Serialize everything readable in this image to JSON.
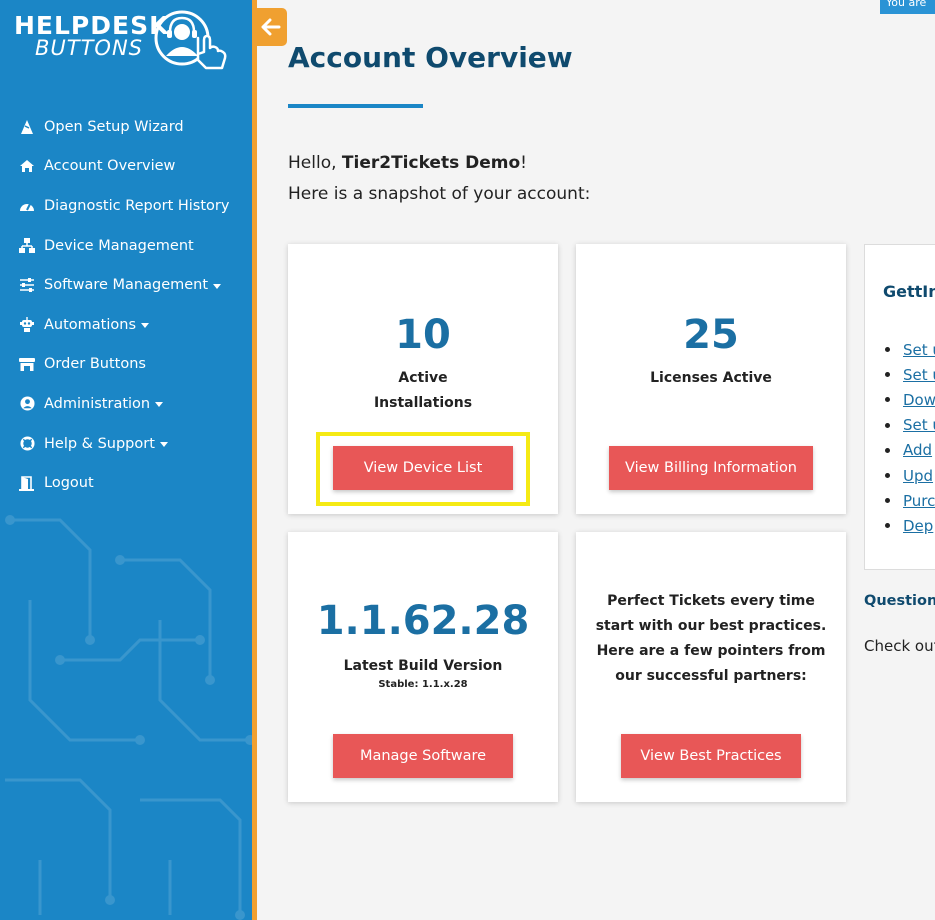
{
  "logo": {
    "line1": "HELPDESK",
    "line2": "BUTTONS"
  },
  "topbar": {
    "chip_text": "You are"
  },
  "nav": [
    {
      "label": "Open Setup Wizard",
      "icon": "wizard-hat-icon",
      "caret": false
    },
    {
      "label": "Account Overview",
      "icon": "home-icon",
      "caret": false
    },
    {
      "label": "Diagnostic Report History",
      "icon": "tachometer-icon",
      "caret": false
    },
    {
      "label": "Device Management",
      "icon": "network-icon",
      "caret": false
    },
    {
      "label": "Software Management",
      "icon": "sliders-icon",
      "caret": true
    },
    {
      "label": "Automations",
      "icon": "robot-icon",
      "caret": true
    },
    {
      "label": "Order Buttons",
      "icon": "store-icon",
      "caret": false
    },
    {
      "label": "Administration",
      "icon": "user-circle-icon",
      "caret": true
    },
    {
      "label": "Help & Support",
      "icon": "life-ring-icon",
      "caret": true
    },
    {
      "label": "Logout",
      "icon": "door-exit-icon",
      "caret": false
    }
  ],
  "page": {
    "title": "Account Overview",
    "greeting_prefix": "Hello, ",
    "greeting_name": "Tier2Tickets Demo",
    "greeting_suffix": "!",
    "subtitle": "Here is a snapshot of your account:"
  },
  "cards": {
    "installations": {
      "value": "10",
      "label_line1": "Active",
      "label_line2": "Installations",
      "button": "View Device List"
    },
    "licenses": {
      "value": "25",
      "label": "Licenses Active",
      "button": "View Billing Information"
    },
    "build": {
      "value": "1.1.62.28",
      "label": "Latest Build Version",
      "sublabel": "Stable: 1.1.x.28",
      "button": "Manage Software"
    },
    "best_practices": {
      "lines": [
        "Perfect Tickets every time",
        "start with our best practices.",
        "Here are a few pointers from",
        "our successful partners:"
      ],
      "button": "View Best Practices"
    }
  },
  "side_panel": {
    "title": "GettIn",
    "links": [
      "Set u",
      "Set u",
      "Dow",
      "Set u",
      "Add",
      "Upd",
      "Purc",
      "Dep"
    ],
    "questions": "Questions",
    "checkout": "Check out"
  },
  "colors": {
    "sidebar": "#1b86c6",
    "accent_orange": "#f0a030",
    "button_red": "#e85757",
    "number_blue": "#1b6fa3",
    "title_navy": "#0f4a6e",
    "highlight_yellow": "#f5ea14"
  }
}
